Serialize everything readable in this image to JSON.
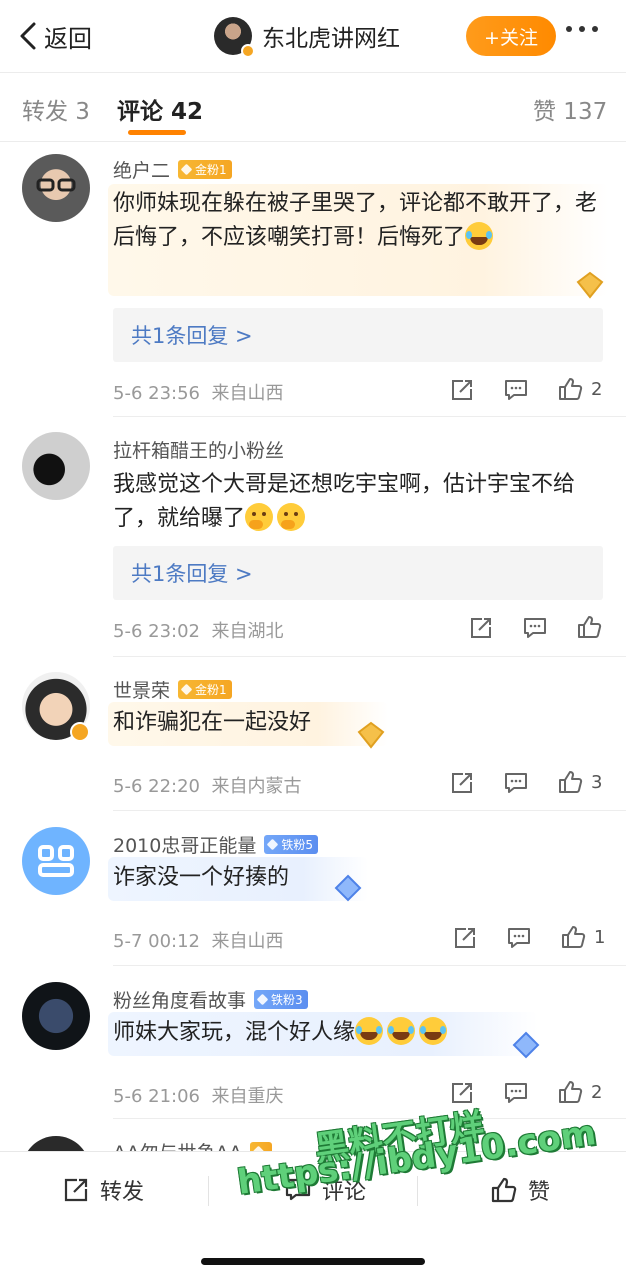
{
  "nav": {
    "back_label": "返回",
    "title": "东北虎讲网红",
    "follow_label": "+关注"
  },
  "tabs": {
    "repost": "转发 3",
    "comments": "评论 42",
    "likes": "赞 137"
  },
  "comments": [
    {
      "username": "绝户二",
      "badge": "金粉1",
      "badge_type": "gold",
      "text": "你师妹现在躲在被子里哭了，评论都不敢开了，老后悔了，不应该嘲笑打哥！后悔死了",
      "emojis": [
        "laugh"
      ],
      "reply_label": "共1条回复 >",
      "time": "5-6 23:56",
      "location": "来自山西",
      "likes": "2"
    },
    {
      "username": "拉杆箱醋王的小粉丝",
      "badge": "",
      "text": "我感觉这个大哥是还想吃宇宝啊，估计宇宝不给了，就给曝了",
      "emojis": [
        "think",
        "think"
      ],
      "reply_label": "共1条回复 >",
      "time": "5-6 23:02",
      "location": "来自湖北",
      "likes": ""
    },
    {
      "username": "世景荣",
      "badge": "金粉1",
      "badge_type": "gold",
      "text": "和诈骗犯在一起没好",
      "time": "5-6 22:20",
      "location": "来自内蒙古",
      "likes": "3"
    },
    {
      "username": "2010忠哥正能量",
      "badge": "铁粉5",
      "badge_type": "iron",
      "text": "诈家没一个好揍的",
      "time": "5-7 00:12",
      "location": "来自山西",
      "likes": "1"
    },
    {
      "username": "粉丝角度看故事",
      "badge": "铁粉3",
      "badge_type": "iron",
      "text": "师妹大家玩，混个好人缘",
      "emojis": [
        "laugh",
        "laugh",
        "laugh"
      ],
      "time": "5-6 21:06",
      "location": "来自重庆",
      "likes": "2"
    },
    {
      "username": "AA勿与世争AA",
      "badge_type": "gold"
    }
  ],
  "bottom": {
    "repost": "转发",
    "comment": "评论",
    "like": "赞"
  },
  "watermark": {
    "line1": "黑料不打烊",
    "line2": "https://ibdy10.com"
  },
  "colors": {
    "accent": "#ff8200",
    "link": "#4d7ac3",
    "gold_badge": "#f5a623",
    "iron_badge": "#5b8ef0"
  }
}
